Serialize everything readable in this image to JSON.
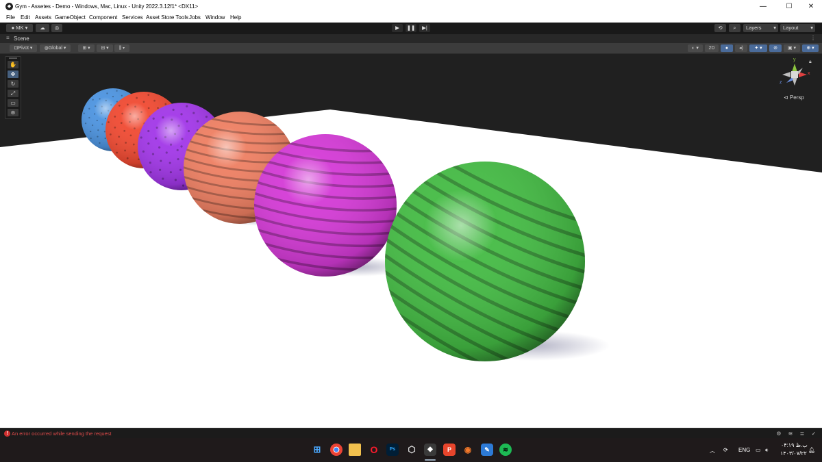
{
  "window": {
    "title": "Gym - Assetes - Demo - Windows, Mac, Linux - Unity 2022.3.12f1* <DX11>",
    "minimize_icon": "minimize-icon",
    "maximize_icon": "maximize-icon",
    "close_icon": "close-icon"
  },
  "menu": [
    "File",
    "Edit",
    "Assets",
    "GameObject",
    "Component",
    "Services",
    "Asset Store Tools",
    "Jobs",
    "Window",
    "Help"
  ],
  "toolbar": {
    "account_label": "MK",
    "layers_label": "Layers",
    "layout_label": "Layout"
  },
  "scene": {
    "tab_label": "Scene",
    "pivot_label": "Pivot",
    "global_label": "Global",
    "mode_2d_label": "2D",
    "persp_label": "Persp",
    "gizmo_y": "y",
    "gizmo_x": "x",
    "gizmo_z": "z"
  },
  "balls": [
    {
      "color": "#4d94e0"
    },
    {
      "color": "#f04a32"
    },
    {
      "color": "#a237e8"
    },
    {
      "color": "#ee7f62"
    },
    {
      "color": "#d43ad6"
    },
    {
      "color": "#44bb44"
    }
  ],
  "status": {
    "error_text": "An error occurred while sending the request"
  },
  "taskbar": {
    "apps": [
      "windows-start-icon",
      "chrome-icon",
      "file-explorer-icon",
      "opera-icon",
      "photoshop-icon",
      "unity-hub-icon",
      "unity-icon",
      "postman-icon",
      "blender-icon",
      "paint-icon",
      "spotify-icon"
    ],
    "language": "ENG",
    "time": "۰۴:۱۹ ب.ظ",
    "date": "۱۴۰۳/۰۷/۲۲"
  }
}
